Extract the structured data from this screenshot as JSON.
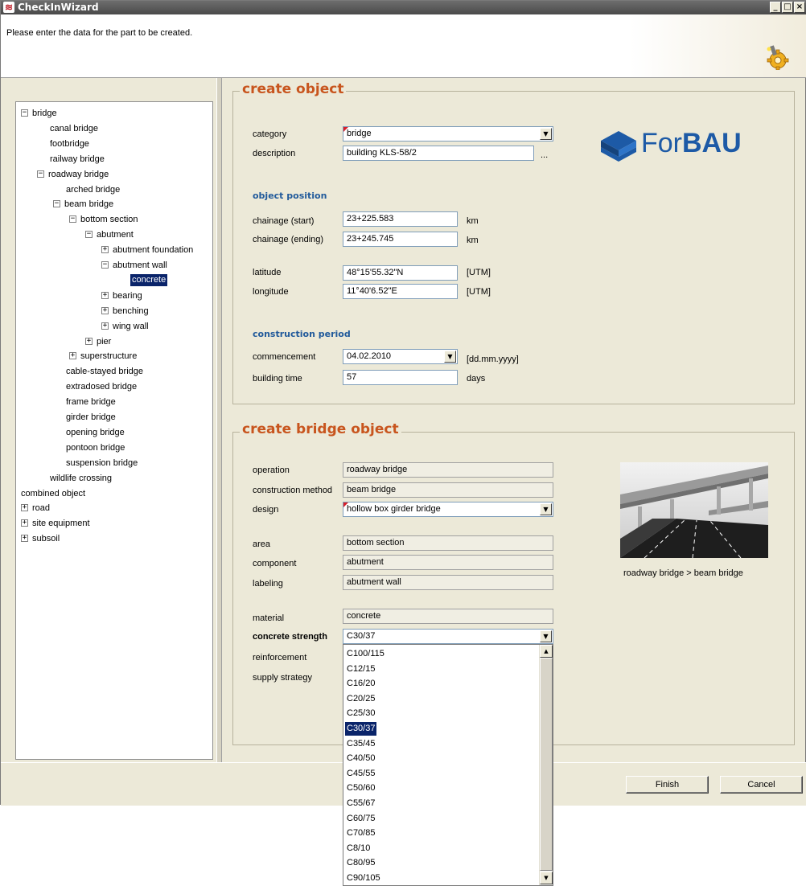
{
  "window": {
    "title": "CheckInWizard",
    "app_icon": "app-icon",
    "controls": {
      "minimize": "_",
      "maximize": "□",
      "close": "×"
    }
  },
  "header": {
    "message": "Please enter the data for the part to be created.",
    "icon": "wizard-gear-icon"
  },
  "tree": {
    "nodes": [
      {
        "label": "bridge",
        "level": 0,
        "toggle": "⊟"
      },
      {
        "label": "canal bridge",
        "level": 1,
        "toggle": ""
      },
      {
        "label": "footbridge",
        "level": 1,
        "toggle": ""
      },
      {
        "label": "railway bridge",
        "level": 1,
        "toggle": ""
      },
      {
        "label": "roadway bridge",
        "level": 1,
        "toggle": "⊟"
      },
      {
        "label": "arched bridge",
        "level": 2,
        "toggle": ""
      },
      {
        "label": "beam bridge",
        "level": 2,
        "toggle": "⊟"
      },
      {
        "label": "bottom section",
        "level": 3,
        "toggle": "⊟"
      },
      {
        "label": "abutment",
        "level": 4,
        "toggle": "⊟"
      },
      {
        "label": "abutment foundation",
        "level": 5,
        "toggle": "⊞"
      },
      {
        "label": "abutment wall",
        "level": 5,
        "toggle": "⊟"
      },
      {
        "label": "concrete",
        "level": 6,
        "toggle": "",
        "selected": true
      },
      {
        "label": "bearing",
        "level": 5,
        "toggle": "⊞"
      },
      {
        "label": "benching",
        "level": 5,
        "toggle": "⊞"
      },
      {
        "label": "wing wall",
        "level": 5,
        "toggle": "⊞"
      },
      {
        "label": "pier",
        "level": 4,
        "toggle": "⊞"
      },
      {
        "label": "superstructure",
        "level": 3,
        "toggle": "⊞"
      },
      {
        "label": "cable-stayed bridge",
        "level": 2,
        "toggle": ""
      },
      {
        "label": "extradosed bridge",
        "level": 2,
        "toggle": ""
      },
      {
        "label": "frame bridge",
        "level": 2,
        "toggle": ""
      },
      {
        "label": "girder bridge",
        "level": 2,
        "toggle": ""
      },
      {
        "label": "opening bridge",
        "level": 2,
        "toggle": ""
      },
      {
        "label": "pontoon bridge",
        "level": 2,
        "toggle": ""
      },
      {
        "label": "suspension bridge",
        "level": 2,
        "toggle": ""
      },
      {
        "label": "wildlife crossing",
        "level": 1,
        "toggle": ""
      },
      {
        "label": "combined object",
        "level": 0,
        "toggle": ""
      },
      {
        "label": "road",
        "level": 0,
        "toggle": "⊞"
      },
      {
        "label": "site equipment",
        "level": 0,
        "toggle": "⊞"
      },
      {
        "label": "subsoil",
        "level": 0,
        "toggle": "⊞"
      }
    ]
  },
  "create_object": {
    "legend": "create object",
    "category_label": "category",
    "category_value": "bridge",
    "description_label": "description",
    "description_value": "building KLS-58/2",
    "description_more": "...",
    "position_title": "object position",
    "chainage_start_label": "chainage (start)",
    "chainage_start_value": "23+225.583",
    "chainage_end_label": "chainage (ending)",
    "chainage_end_value": "23+245.745",
    "km_unit": "km",
    "latitude_label": "latitude",
    "latitude_value": "48°15'55.32\"N",
    "longitude_label": "longitude",
    "longitude_value": "11°40'6.52\"E",
    "utm_unit": "[UTM]",
    "period_title": "construction period",
    "commencement_label": "commencement",
    "commencement_value": "04.02.2010",
    "date_format": "[dd.mm.yyyy]",
    "building_time_label": "building time",
    "building_time_value": "57",
    "days_unit": "days",
    "logo_prefix": "For",
    "logo_bold": "BAU"
  },
  "create_bridge": {
    "legend": "create bridge object",
    "operation_label": "operation",
    "operation_value": "roadway bridge",
    "construction_method_label": "construction method",
    "construction_method_value": "beam bridge",
    "design_label": "design",
    "design_value": "hollow box girder bridge",
    "area_label": "area",
    "area_value": "bottom section",
    "component_label": "component",
    "component_value": "abutment",
    "labeling_label": "labeling",
    "labeling_value": "abutment wall",
    "material_label": "material",
    "material_value": "concrete",
    "concrete_strength_label": "concrete strength",
    "concrete_strength_value": "C30/37",
    "reinforcement_label": "reinforcement",
    "supply_strategy_label": "supply strategy",
    "image_caption": "roadway bridge > beam bridge"
  },
  "dropdown": {
    "options": [
      "C100/115",
      "C12/15",
      "C16/20",
      "C20/25",
      "C25/30",
      "C30/37",
      "C35/45",
      "C40/50",
      "C45/55",
      "C50/60",
      "C55/67",
      "C60/75",
      "C70/85",
      "C8/10",
      "C80/95",
      "C90/105"
    ],
    "selected": "C30/37"
  },
  "buttons": {
    "finish": "Finish",
    "cancel": "Cancel"
  },
  "colors": {
    "legend": "#c8551e",
    "subtitle": "#215a9b",
    "selection": "#0a246a",
    "logo": "#1d5aa6"
  }
}
